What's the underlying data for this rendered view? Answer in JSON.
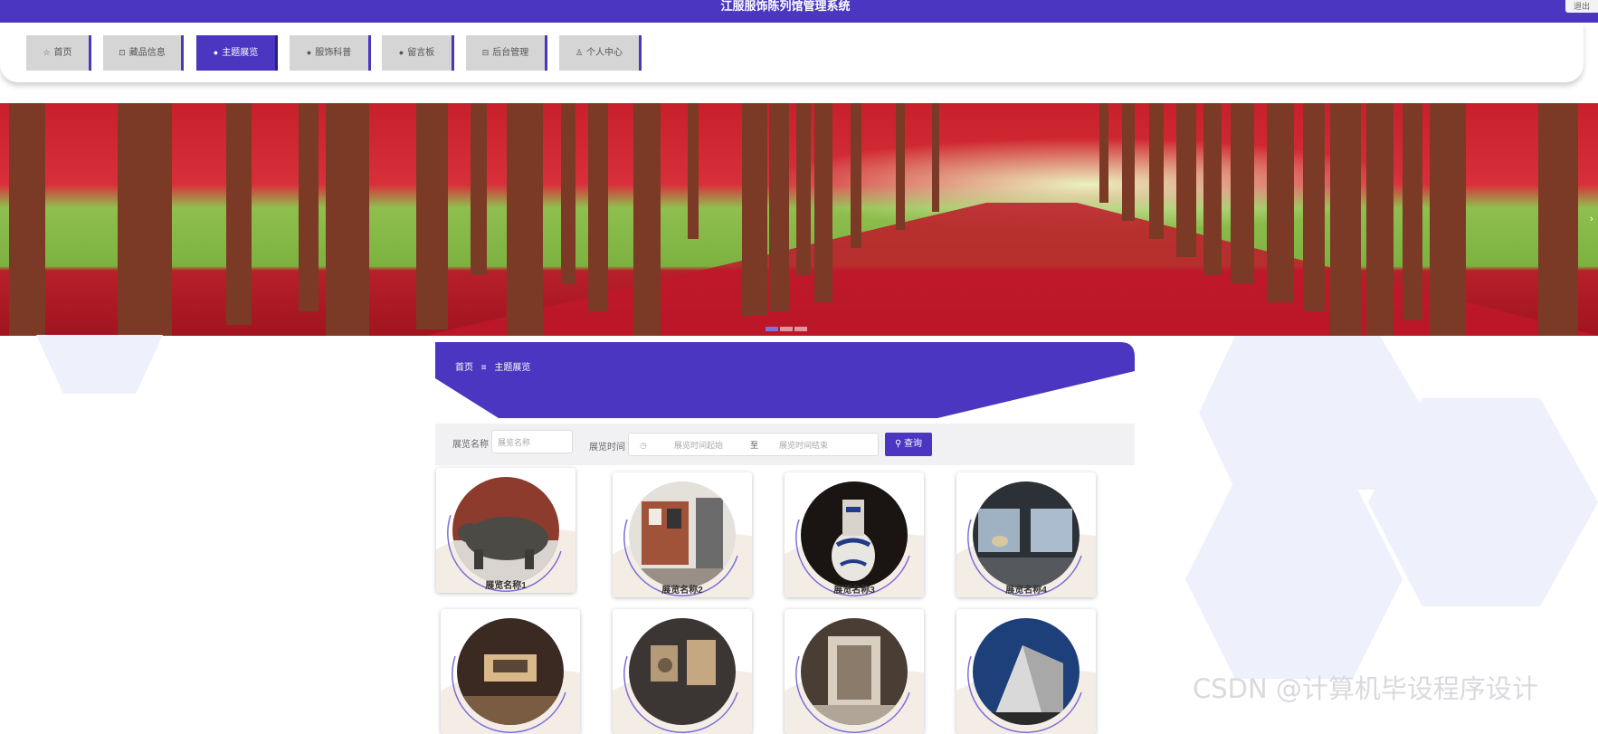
{
  "header": {
    "title": "江服服饰陈列馆管理系统",
    "logout": "退出"
  },
  "nav": {
    "items": [
      {
        "icon": "☆",
        "label": "首页",
        "active": false
      },
      {
        "icon": "⊡",
        "label": "藏品信息",
        "active": false
      },
      {
        "icon": "●",
        "label": "主题展览",
        "active": true
      },
      {
        "icon": "●",
        "label": "服饰科普",
        "active": false
      },
      {
        "icon": "●",
        "label": "留言板",
        "active": false
      },
      {
        "icon": "⊟",
        "label": "后台管理",
        "active": false
      },
      {
        "icon": "♙",
        "label": "个人中心",
        "active": false
      }
    ]
  },
  "banner": {
    "dots": 3,
    "active_dot": 0
  },
  "breadcrumb": {
    "items": [
      "首页",
      "≡",
      "主题展览"
    ]
  },
  "search": {
    "name_label": "展览名称",
    "name_placeholder": "展览名称",
    "time_label": "展览时间",
    "time_start_placeholder": "展览时间起始",
    "time_sep": "至",
    "time_end_placeholder": "展览时间结束",
    "query_button": "查询"
  },
  "exhibitions": [
    {
      "name": "展览名称1",
      "theme": "bronze-rhino"
    },
    {
      "name": "展览名称2",
      "theme": "gallery-wall"
    },
    {
      "name": "展览名称3",
      "theme": "blue-vase"
    },
    {
      "name": "展览名称4",
      "theme": "museum-hall"
    },
    {
      "name": "",
      "theme": "corridor"
    },
    {
      "name": "",
      "theme": "carving"
    },
    {
      "name": "",
      "theme": "atrium"
    },
    {
      "name": "",
      "theme": "building"
    }
  ],
  "watermark": "CSDN @计算机毕设程序设计",
  "colors": {
    "primary": "#4a36c0",
    "hex": "#eef0fb"
  }
}
